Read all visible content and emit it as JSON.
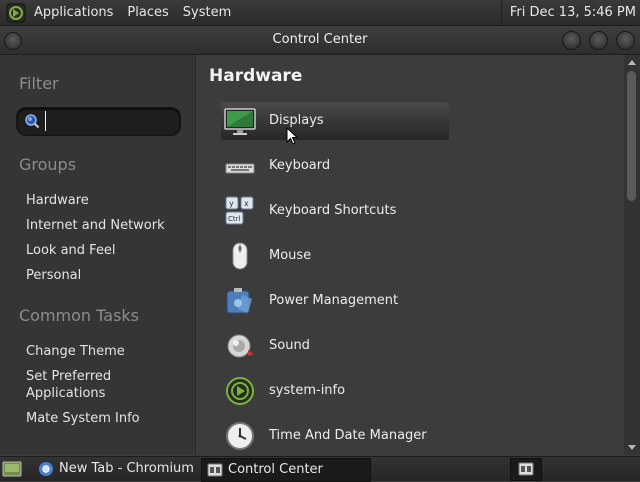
{
  "top_panel": {
    "menus": [
      "Applications",
      "Places",
      "System"
    ],
    "clock": "Fri Dec 13,  5:46 PM"
  },
  "window": {
    "title": "Control Center"
  },
  "sidebar": {
    "filter_heading": "Filter",
    "search": {
      "value": "",
      "placeholder": ""
    },
    "groups_heading": "Groups",
    "groups": [
      "Hardware",
      "Internet and Network",
      "Look and Feel",
      "Personal"
    ],
    "tasks_heading": "Common Tasks",
    "tasks": [
      "Change Theme",
      "Set Preferred\nApplications",
      "Mate System Info"
    ]
  },
  "main": {
    "section_title": "Hardware",
    "items": [
      {
        "label": "Displays",
        "icon": "display-icon",
        "selected": true
      },
      {
        "label": "Keyboard",
        "icon": "keyboard-icon"
      },
      {
        "label": "Keyboard Shortcuts",
        "icon": "keyboard-shortcuts-icon"
      },
      {
        "label": "Mouse",
        "icon": "mouse-icon"
      },
      {
        "label": "Power Management",
        "icon": "power-management-icon"
      },
      {
        "label": "Sound",
        "icon": "sound-icon"
      },
      {
        "label": "system-info",
        "icon": "system-info-icon"
      },
      {
        "label": "Time And Date Manager",
        "icon": "clock-icon"
      }
    ]
  },
  "taskbar": {
    "tasks": [
      {
        "label": "New Tab - Chromium",
        "icon": "chromium-icon"
      },
      {
        "label": "Control Center",
        "icon": "control-center-icon",
        "active": true
      }
    ]
  },
  "colors": {
    "accent_green": "#7fb03f",
    "background": "#3c3c3c",
    "sidebar": "#353535"
  }
}
